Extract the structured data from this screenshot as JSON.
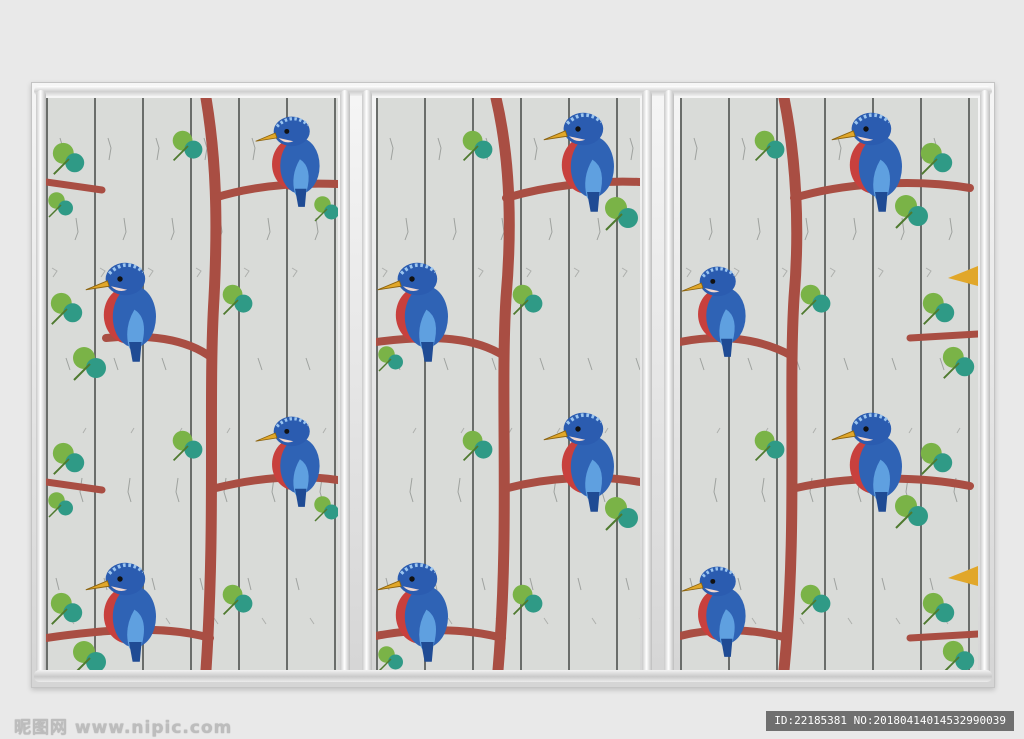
{
  "footer": {
    "watermark": "昵图网 www.nipic.com",
    "image_id": "ID:22185381 NO:20180414014532990039"
  },
  "colors": {
    "wall": "#e9e9e9",
    "wood": "#d9dbd8",
    "branch": "#a94e43",
    "leaf": "#7ab347",
    "bird_blue": "#2f63b5",
    "bird_breast": "#c8403d",
    "beak": "#e1a72a"
  },
  "panels": [
    {
      "name": "left-panel"
    },
    {
      "name": "middle-panel"
    },
    {
      "name": "right-panel"
    }
  ]
}
